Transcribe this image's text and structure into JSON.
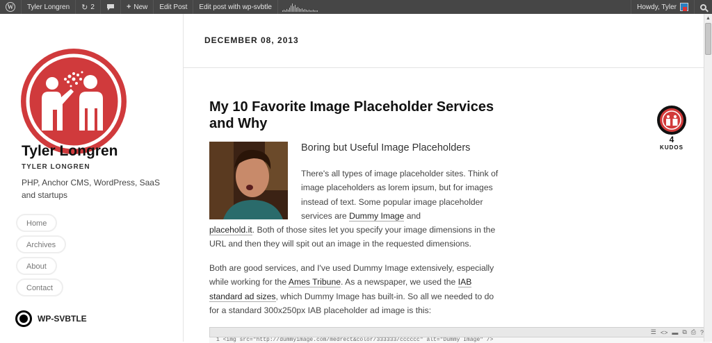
{
  "adminbar": {
    "updates_count": "2",
    "new_label": "New",
    "edit_post_label": "Edit Post",
    "edit_svbtle_label": "Edit post with wp-svbtle",
    "greeting": "Howdy, Tyler"
  },
  "sidebar": {
    "blog_title": "Tyler Longren",
    "blog_subtitle": "TYLER LONGREN",
    "description": "PHP, Anchor CMS, WordPress, SaaS and startups",
    "nav": [
      {
        "label": "Home"
      },
      {
        "label": "Archives"
      },
      {
        "label": "About"
      },
      {
        "label": "Contact"
      }
    ],
    "svbtle_label": "WP-SVBTLE"
  },
  "post": {
    "date": "DECEMBER 08, 2013",
    "title": "My 10 Favorite Image Placeholder Services and Why",
    "intro_heading": "Boring but Useful Image Placeholders",
    "p1_start": "There's all types of image placeholder sites. Think of image placeholders as lorem ipsum, but for images instead of text. Some popular image placeholder services are ",
    "p1_link1": "Dummy Image",
    "p1_and": " and",
    "p1_link2": "placehold.it",
    "p1_end": ". Both of those sites let you specify your image dimensions in the URL and then they will spit out an image in the requested dimensions.",
    "p2_start": "Both are good services, and I've used Dummy Image extensively, especially while working for the ",
    "p2_link1": "Ames Tribune",
    "p2_mid": ". As a newspaper, we used the ",
    "p2_link2": "IAB standard ad sizes",
    "p2_end": ", which Dummy Image has built-in. So all we needed to do for a standard 300x250px IAB placeholder ad image is this:",
    "code_line": "1  <img src=\"http://dummyimage.com/medrect&color/333333/cccccc\" alt=\"Dummy Image\" />"
  },
  "kudos": {
    "count": "4",
    "label": "KUDOS"
  }
}
